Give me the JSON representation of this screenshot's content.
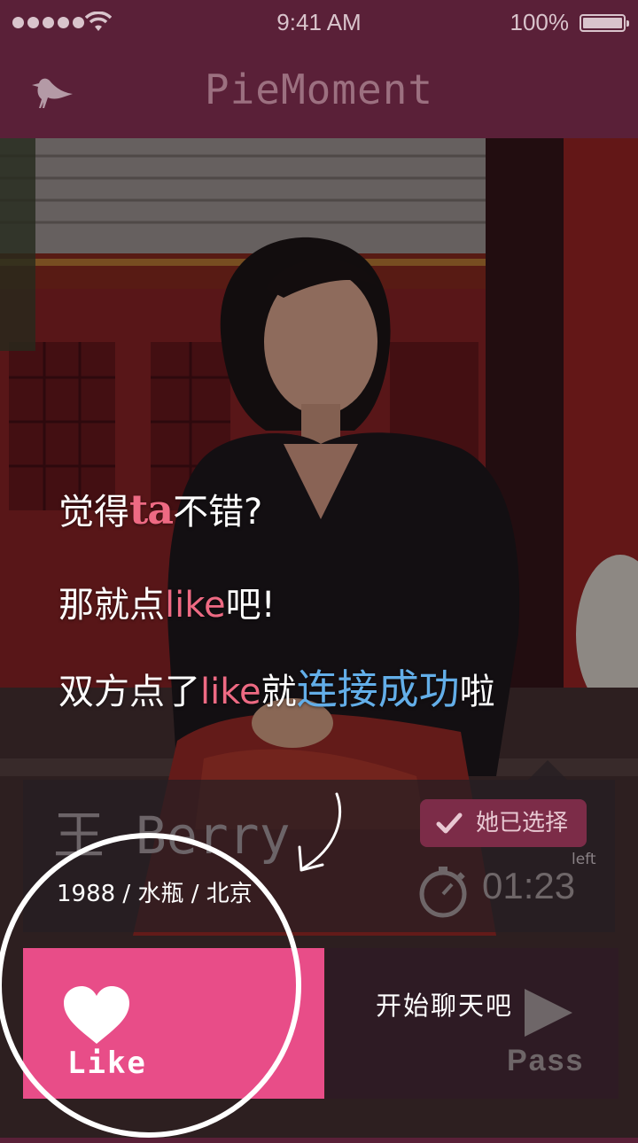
{
  "status_bar": {
    "time": "9:41 AM",
    "battery": "100%"
  },
  "nav": {
    "title": "PieMoment",
    "icon": "bird-icon"
  },
  "tutorial": {
    "line1_pre": "觉得",
    "line1_ta": "ta",
    "line1_post": "不错?",
    "line2_pre": "那就点",
    "line2_like": "like",
    "line2_post": "吧!",
    "line3_pre": "双方点了",
    "line3_like": "like",
    "line3_mid": "就",
    "line3_success": "连接成功",
    "line3_post": "啦",
    "chat_hint": "开始聊天吧"
  },
  "profile": {
    "name": "王 Berry",
    "info": "1988 / 水瓶 / 北京",
    "badge": "她已选择",
    "timer_label": "left",
    "timer": "01:23"
  },
  "actions": {
    "like": "Like",
    "pass": "Pass"
  },
  "colors": {
    "nav": "#5a2038",
    "like": "#e84d88",
    "accent_pink": "#ee6a83",
    "accent_blue": "#63aee8"
  }
}
